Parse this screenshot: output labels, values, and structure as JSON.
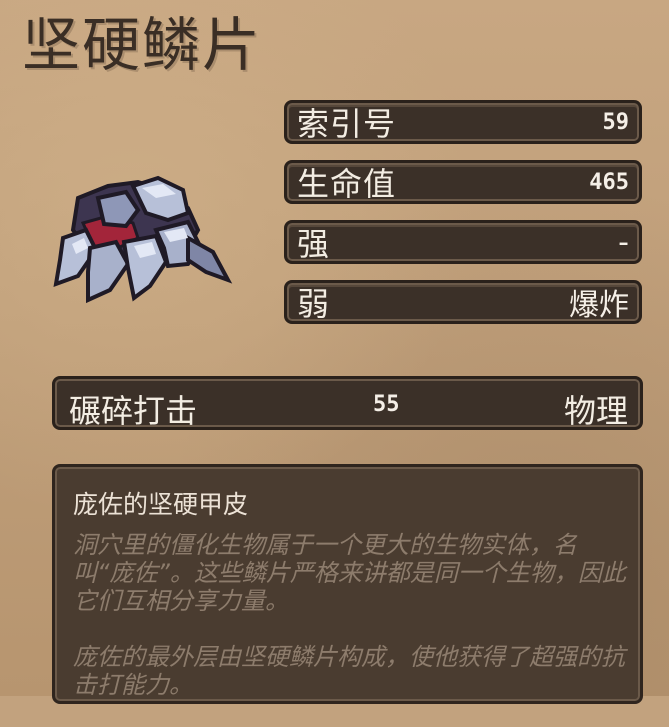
{
  "title": "坚硬鳞片",
  "stats": {
    "index_label": "索引号",
    "index_value": "59",
    "hp_label": "生命值",
    "hp_value": "465",
    "strong_label": "强",
    "strong_value": "-",
    "weak_label": "弱",
    "weak_value": "爆炸"
  },
  "attack": {
    "name": "碾碎打击",
    "power": "55",
    "type": "物理"
  },
  "description": {
    "heading": "庞佐的坚硬甲皮",
    "paragraph1": "洞穴里的僵化生物属于一个更大的生物实体，名叫“庞佐”。这些鳞片严格来讲都是同一个生物，因此它们互相分享力量。",
    "paragraph2": "庞佐的最外层由坚硬鳞片构成，使他获得了超强的抗击打能力。"
  },
  "portrait": {
    "icon": "hard-scale-creature-sprite",
    "colors": {
      "shell_light": "#b7c0d8",
      "shell_mid": "#7f86a6",
      "shell_dark": "#3d3550",
      "flesh_red": "#a3253a",
      "outline": "#1f1a26"
    }
  }
}
